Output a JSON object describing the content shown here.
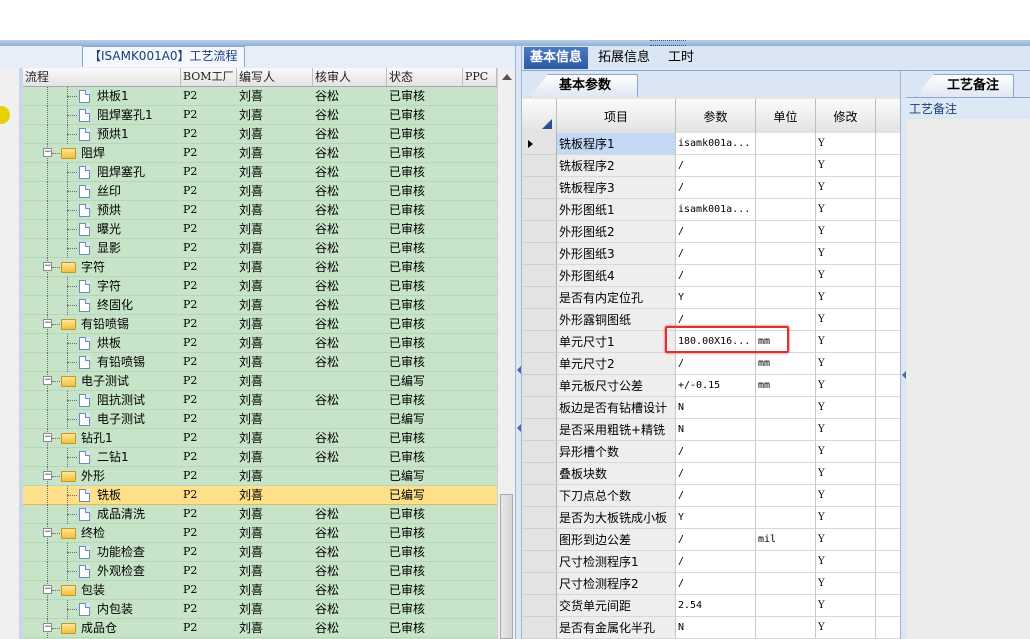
{
  "left_panel": {
    "title": "【ISAMK001A0】工艺流程",
    "columns": [
      "流程",
      "BOM工厂",
      "编写人",
      "核审人",
      "状态",
      "PPC"
    ],
    "rows": [
      {
        "level": 2,
        "type": "file",
        "name": "烘板1",
        "bom": "P2",
        "writer": "刘喜",
        "reviewer": "谷松",
        "status": "已审核"
      },
      {
        "level": 2,
        "type": "file",
        "name": "阻焊塞孔1",
        "bom": "P2",
        "writer": "刘喜",
        "reviewer": "谷松",
        "status": "已审核"
      },
      {
        "level": 2,
        "type": "file",
        "name": "预烘1",
        "bom": "P2",
        "writer": "刘喜",
        "reviewer": "谷松",
        "status": "已审核"
      },
      {
        "level": 1,
        "type": "folder",
        "name": "阻焊",
        "bom": "P2",
        "writer": "刘喜",
        "reviewer": "谷松",
        "status": "已审核"
      },
      {
        "level": 2,
        "type": "file",
        "name": "阻焊塞孔",
        "bom": "P2",
        "writer": "刘喜",
        "reviewer": "谷松",
        "status": "已审核"
      },
      {
        "level": 2,
        "type": "file",
        "name": "丝印",
        "bom": "P2",
        "writer": "刘喜",
        "reviewer": "谷松",
        "status": "已审核"
      },
      {
        "level": 2,
        "type": "file",
        "name": "预烘",
        "bom": "P2",
        "writer": "刘喜",
        "reviewer": "谷松",
        "status": "已审核"
      },
      {
        "level": 2,
        "type": "file",
        "name": "曝光",
        "bom": "P2",
        "writer": "刘喜",
        "reviewer": "谷松",
        "status": "已审核"
      },
      {
        "level": 2,
        "type": "file",
        "name": "显影",
        "bom": "P2",
        "writer": "刘喜",
        "reviewer": "谷松",
        "status": "已审核"
      },
      {
        "level": 1,
        "type": "folder",
        "name": "字符",
        "bom": "P2",
        "writer": "刘喜",
        "reviewer": "谷松",
        "status": "已审核"
      },
      {
        "level": 2,
        "type": "file",
        "name": "字符",
        "bom": "P2",
        "writer": "刘喜",
        "reviewer": "谷松",
        "status": "已审核"
      },
      {
        "level": 2,
        "type": "file",
        "name": "终固化",
        "bom": "P2",
        "writer": "刘喜",
        "reviewer": "谷松",
        "status": "已审核"
      },
      {
        "level": 1,
        "type": "folder",
        "name": "有铅喷锡",
        "bom": "P2",
        "writer": "刘喜",
        "reviewer": "谷松",
        "status": "已审核"
      },
      {
        "level": 2,
        "type": "file",
        "name": "烘板",
        "bom": "P2",
        "writer": "刘喜",
        "reviewer": "谷松",
        "status": "已审核"
      },
      {
        "level": 2,
        "type": "file",
        "name": "有铅喷锡",
        "bom": "P2",
        "writer": "刘喜",
        "reviewer": "谷松",
        "status": "已审核"
      },
      {
        "level": 1,
        "type": "folder",
        "name": "电子测试",
        "bom": "P2",
        "writer": "刘喜",
        "reviewer": "",
        "status": "已编写"
      },
      {
        "level": 2,
        "type": "file",
        "name": "阻抗测试",
        "bom": "P2",
        "writer": "刘喜",
        "reviewer": "谷松",
        "status": "已审核"
      },
      {
        "level": 2,
        "type": "file",
        "name": "电子测试",
        "bom": "P2",
        "writer": "刘喜",
        "reviewer": "",
        "status": "已编写"
      },
      {
        "level": 1,
        "type": "folder",
        "name": "钻孔1",
        "bom": "P2",
        "writer": "刘喜",
        "reviewer": "谷松",
        "status": "已审核"
      },
      {
        "level": 2,
        "type": "file",
        "name": "二钻1",
        "bom": "P2",
        "writer": "刘喜",
        "reviewer": "谷松",
        "status": "已审核"
      },
      {
        "level": 1,
        "type": "folder",
        "name": "外形",
        "bom": "P2",
        "writer": "刘喜",
        "reviewer": "",
        "status": "已编写"
      },
      {
        "level": 2,
        "type": "file",
        "name": "铣板",
        "bom": "P2",
        "writer": "刘喜",
        "reviewer": "",
        "status": "已编写",
        "selected": true
      },
      {
        "level": 2,
        "type": "file",
        "name": "成品清洗",
        "bom": "P2",
        "writer": "刘喜",
        "reviewer": "谷松",
        "status": "已审核"
      },
      {
        "level": 1,
        "type": "folder",
        "name": "终检",
        "bom": "P2",
        "writer": "刘喜",
        "reviewer": "谷松",
        "status": "已审核"
      },
      {
        "level": 2,
        "type": "file",
        "name": "功能检查",
        "bom": "P2",
        "writer": "刘喜",
        "reviewer": "谷松",
        "status": "已审核"
      },
      {
        "level": 2,
        "type": "file",
        "name": "外观检查",
        "bom": "P2",
        "writer": "刘喜",
        "reviewer": "谷松",
        "status": "已审核"
      },
      {
        "level": 1,
        "type": "folder",
        "name": "包装",
        "bom": "P2",
        "writer": "刘喜",
        "reviewer": "谷松",
        "status": "已审核"
      },
      {
        "level": 2,
        "type": "file",
        "name": "内包装",
        "bom": "P2",
        "writer": "刘喜",
        "reviewer": "谷松",
        "status": "已审核"
      },
      {
        "level": 1,
        "type": "folder",
        "name": "成品仓",
        "bom": "P2",
        "writer": "刘喜",
        "reviewer": "谷松",
        "status": "已审核"
      }
    ]
  },
  "tabs": [
    "基本信息",
    "拓展信息",
    "工时"
  ],
  "active_tab": "基本信息",
  "basic_params": {
    "subtab": "基本参数",
    "columns": [
      "项目",
      "参数",
      "单位",
      "修改"
    ],
    "rows": [
      {
        "item": "铣板程序1",
        "param": "isamk001a...",
        "unit": "",
        "mod": "Y",
        "current": true
      },
      {
        "item": "铣板程序2",
        "param": "/",
        "unit": "",
        "mod": "Y"
      },
      {
        "item": "铣板程序3",
        "param": "/",
        "unit": "",
        "mod": "Y"
      },
      {
        "item": "外形图纸1",
        "param": "isamk001a...",
        "unit": "",
        "mod": "Y"
      },
      {
        "item": "外形图纸2",
        "param": "/",
        "unit": "",
        "mod": "Y"
      },
      {
        "item": "外形图纸3",
        "param": "/",
        "unit": "",
        "mod": "Y"
      },
      {
        "item": "外形图纸4",
        "param": "/",
        "unit": "",
        "mod": "Y"
      },
      {
        "item": "是否有内定位孔",
        "param": "Y",
        "unit": "",
        "mod": "Y"
      },
      {
        "item": "外形露铜图纸",
        "param": "/",
        "unit": "",
        "mod": "Y"
      },
      {
        "item": "单元尺寸1",
        "param": "180.00X16...",
        "unit": "mm",
        "mod": "Y",
        "highlighted": true
      },
      {
        "item": "单元尺寸2",
        "param": "/",
        "unit": "mm",
        "mod": "Y"
      },
      {
        "item": "单元板尺寸公差",
        "param": "+/-0.15",
        "unit": "mm",
        "mod": "Y"
      },
      {
        "item": "板边是否有钻槽设计",
        "param": "N",
        "unit": "",
        "mod": "Y"
      },
      {
        "item": "是否采用粗铣+精铣",
        "param": "N",
        "unit": "",
        "mod": "Y"
      },
      {
        "item": "异形槽个数",
        "param": "/",
        "unit": "",
        "mod": "Y"
      },
      {
        "item": "叠板块数",
        "param": "/",
        "unit": "",
        "mod": "Y"
      },
      {
        "item": "下刀点总个数",
        "param": "/",
        "unit": "",
        "mod": "Y"
      },
      {
        "item": "是否为大板铣成小板",
        "param": "Y",
        "unit": "",
        "mod": "Y"
      },
      {
        "item": "图形到边公差",
        "param": "/",
        "unit": "mil",
        "mod": "Y"
      },
      {
        "item": "尺寸检测程序1",
        "param": "/",
        "unit": "",
        "mod": "Y"
      },
      {
        "item": "尺寸检测程序2",
        "param": "/",
        "unit": "",
        "mod": "Y"
      },
      {
        "item": "交货单元间距",
        "param": "2.54",
        "unit": "",
        "mod": "Y"
      },
      {
        "item": "是否有金属化半孔",
        "param": "N",
        "unit": "",
        "mod": "Y"
      }
    ]
  },
  "memo": {
    "tab": "工艺备注",
    "label": "工艺备注"
  },
  "colors": {
    "tree_bg": "#c8e4c8",
    "selected_row": "#ffe08a",
    "tab_active": "#2d5aa4",
    "highlight_box": "#e03030"
  }
}
